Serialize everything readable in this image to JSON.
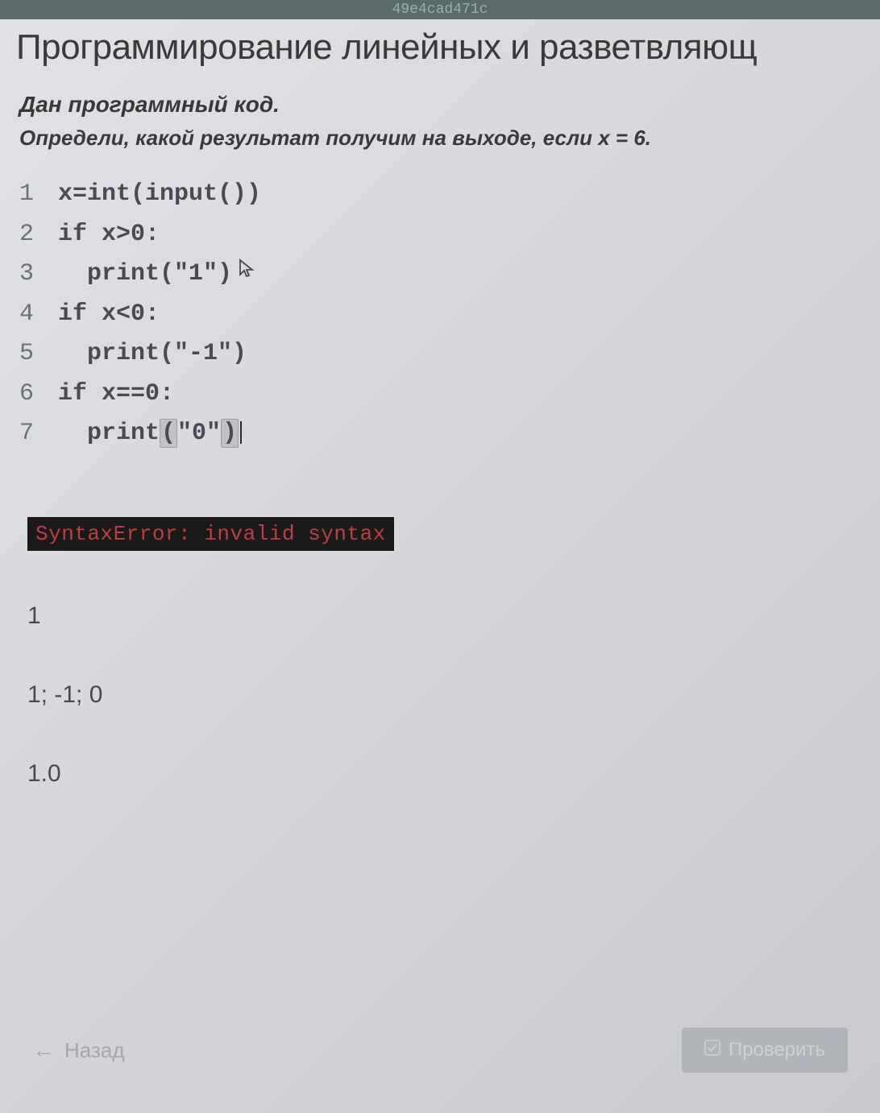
{
  "header_strip": "49e4cad471c",
  "main_title": "Программирование линейных и разветвляющ",
  "prompt": {
    "line1": "Дан программный код.",
    "line2": "Определи, какой результат получим на выходе, если x = 6."
  },
  "code": {
    "lines": [
      {
        "num": "1",
        "text": "x=int(input())"
      },
      {
        "num": "2",
        "text": "if x>0:"
      },
      {
        "num": "3",
        "text": "  print(\"1\")",
        "cursor_arrow": true
      },
      {
        "num": "4",
        "text": "if x<0:"
      },
      {
        "num": "5",
        "text": "  print(\"-1\")"
      },
      {
        "num": "6",
        "text": "if x==0:"
      },
      {
        "num": "7",
        "text_before": "  print",
        "bracket_open": "(",
        "text_mid": "\"0\"",
        "bracket_close": ")",
        "has_cursor": true
      }
    ]
  },
  "answers": {
    "error": "SyntaxError: invalid syntax",
    "opt1": "1",
    "opt2": "1; -1; 0",
    "opt3": "1.0"
  },
  "footer": {
    "back_label": "Назад",
    "check_label": "Проверить"
  }
}
